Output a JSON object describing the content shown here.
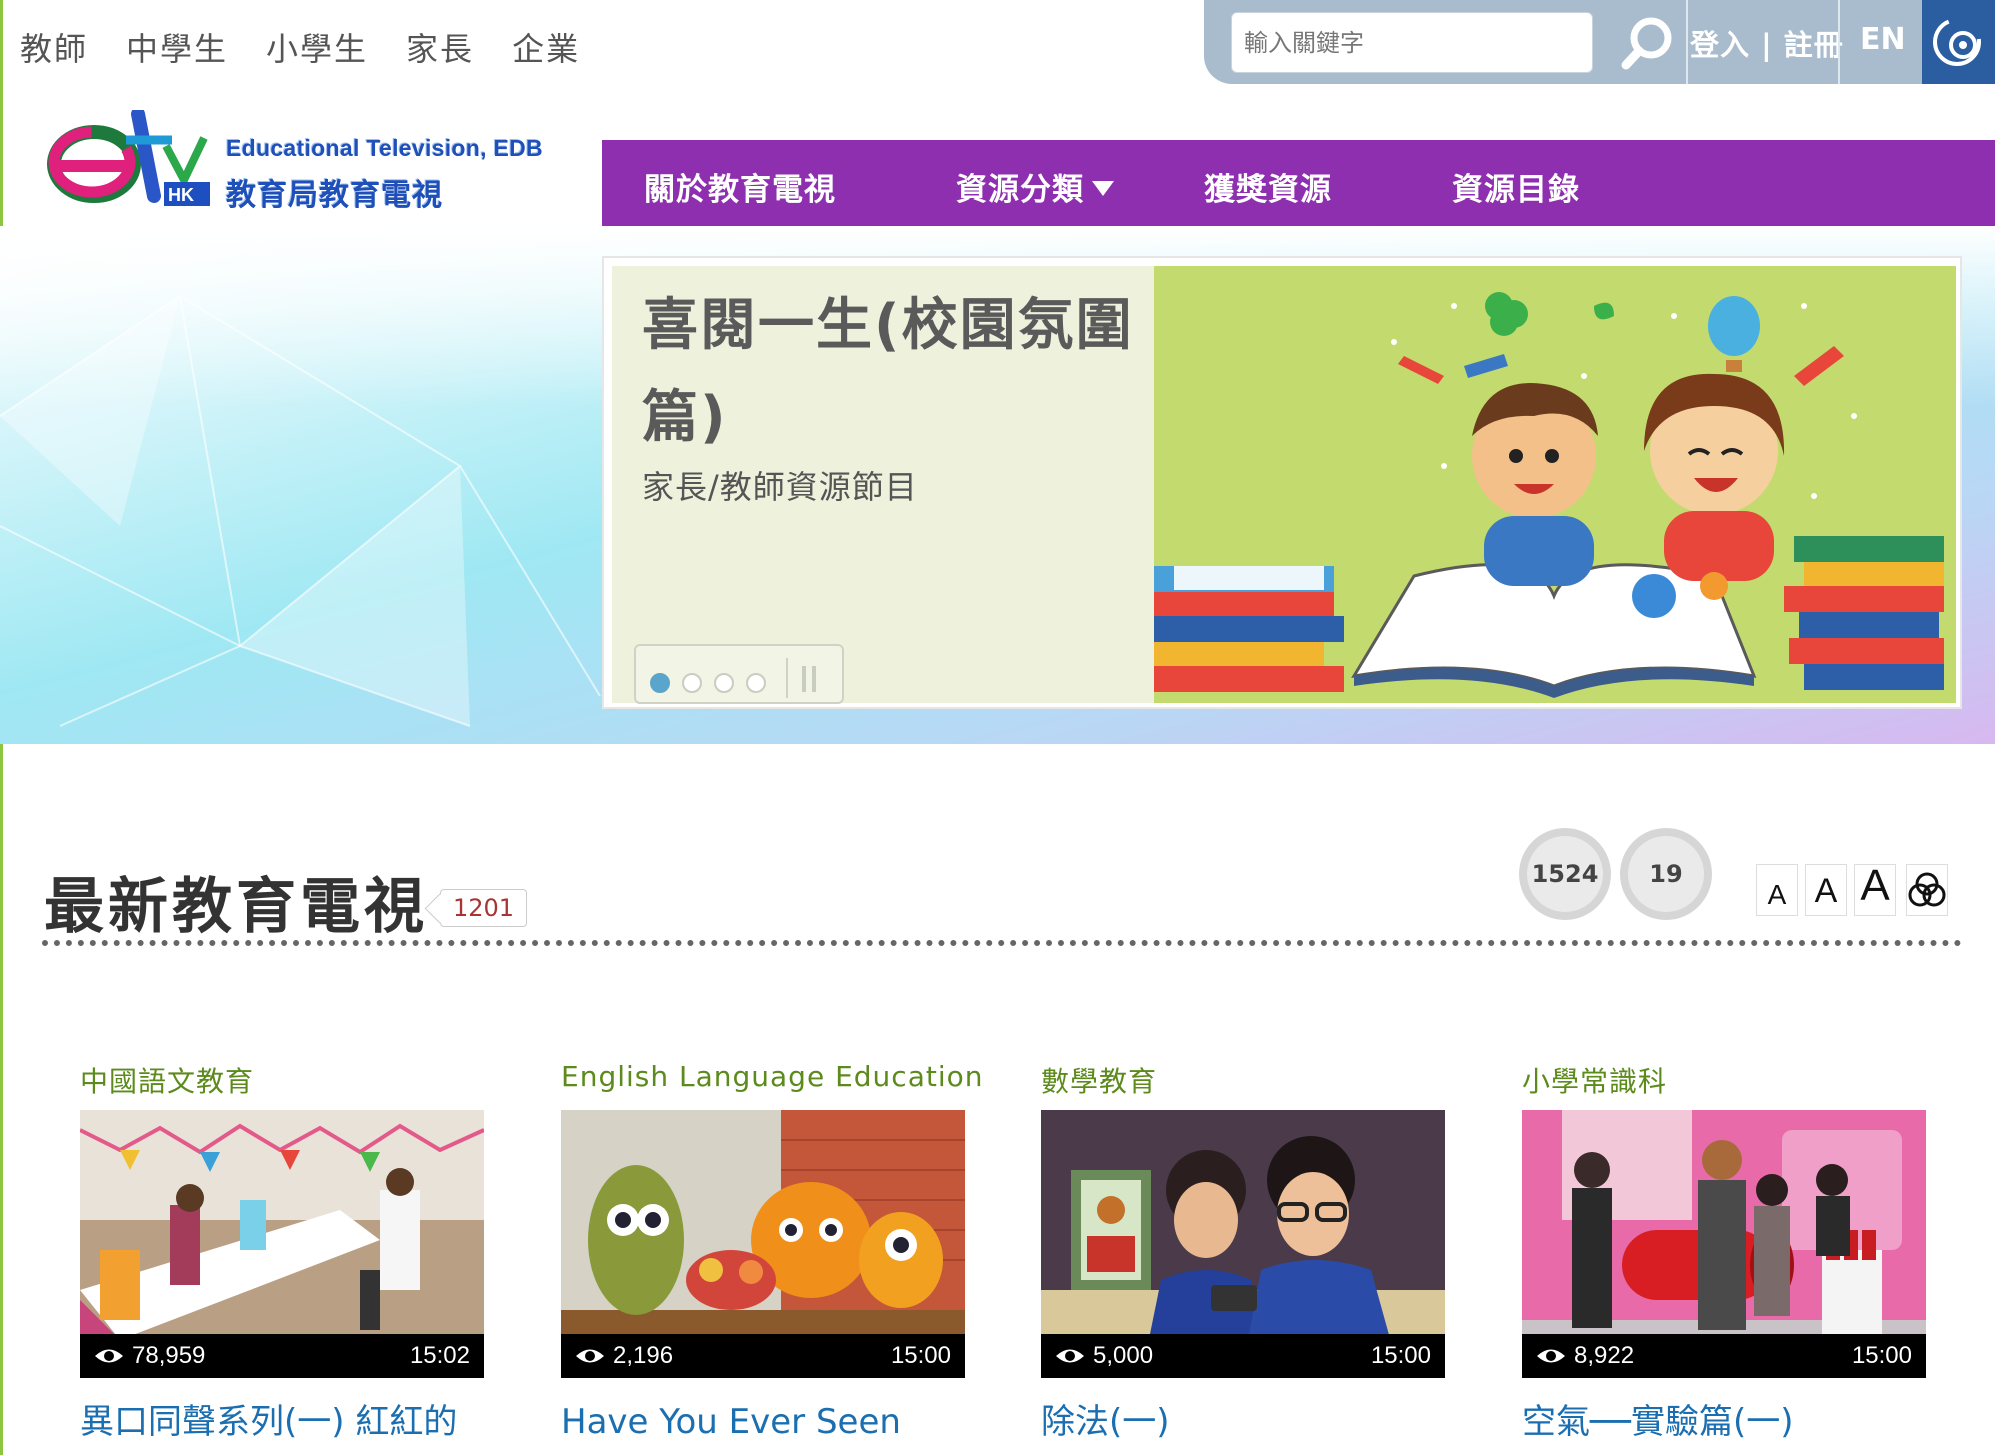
{
  "audience_nav": [
    "教師",
    "中學生",
    "小學生",
    "家長",
    "企業"
  ],
  "search": {
    "placeholder": "輸入關鍵字"
  },
  "account": {
    "login_register": "登入 | 註冊",
    "language": "EN"
  },
  "logo": {
    "en": "Educational Television, EDB",
    "zh": "教育局教育電視"
  },
  "main_nav": [
    {
      "label": "關於教育電視"
    },
    {
      "label": "資源分類"
    },
    {
      "label": "獲獎資源"
    },
    {
      "label": "資源目錄"
    }
  ],
  "banner": {
    "title": "喜閱一生(校園氛圍篇)",
    "subtitle": "家長/教師資源節目",
    "active_slide": 1,
    "slide_count": 4
  },
  "section": {
    "title": "最新教育電視",
    "count": "1201",
    "likes": "1524",
    "shares": "19"
  },
  "font_size_controls": [
    "A",
    "A",
    "A"
  ],
  "cards": [
    {
      "category": "中國語文教育",
      "views": "78,959",
      "duration": "15:02",
      "title": "異口同聲系列(一) 紅紅的生日會 (粵語、廣東話)"
    },
    {
      "category": "English Language Education",
      "views": "2,196",
      "duration": "15:00",
      "title": "Have You Ever Seen the Monster?"
    },
    {
      "category": "數學教育",
      "views": "5,000",
      "duration": "15:00",
      "title": "除法(一)"
    },
    {
      "category": "小學常識科",
      "views": "8,922",
      "duration": "15:00",
      "title": "空氣──實驗篇(一)"
    }
  ],
  "colors": {
    "nav_purple": "#8e2faf",
    "accent_green": "#5c8b1c",
    "link_blue": "#1b6fb0",
    "topbar_grey": "#a9bccd",
    "a11y_blue": "#2a5ea1"
  }
}
